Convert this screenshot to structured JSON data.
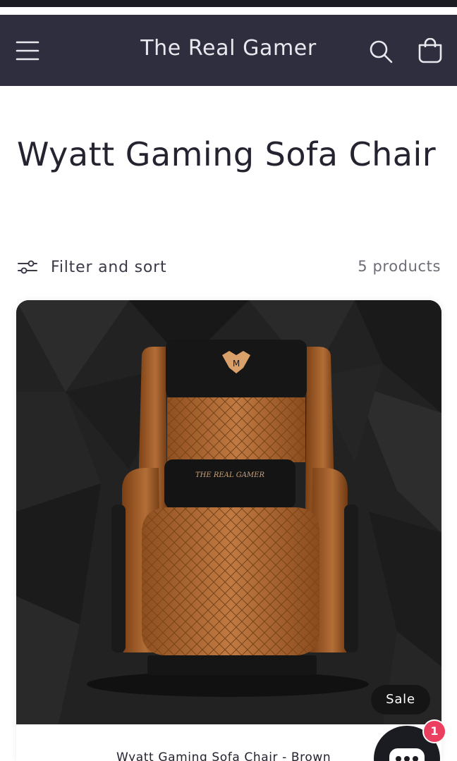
{
  "header": {
    "brand": "The Real Gamer",
    "icons": {
      "menu": "menu-icon",
      "search": "search-icon",
      "cart": "cart-icon"
    },
    "background": "#2f2e3e"
  },
  "collection": {
    "title": "Wyatt Gaming Sofa Chair",
    "filter_label": "Filter and sort",
    "product_count": "5 products"
  },
  "products": [
    {
      "title": "Wyatt Gaming Sofa Chair - Brown",
      "badge": "Sale",
      "image": {
        "description_icon": "gaming-sofa-chair-image",
        "headrest_text": "THE REAL GAMER"
      }
    }
  ],
  "chat": {
    "unread_count": "1",
    "badge_color": "#ea3f5f"
  }
}
